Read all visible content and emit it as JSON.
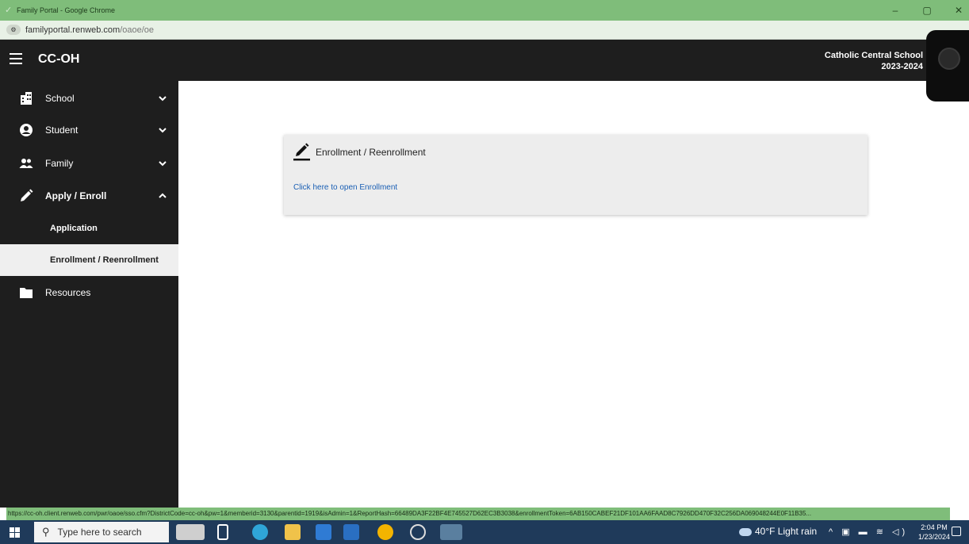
{
  "browser": {
    "window_title": "Family Portal - Google Chrome",
    "url_host": "familyportal.renweb.com",
    "url_path": "/oaoe/oe",
    "controls": {
      "minimize": "–",
      "restore": "▢",
      "close": "✕"
    }
  },
  "header": {
    "app_name": "CC-OH",
    "school_name": "Catholic Central School",
    "school_year": "2023-2024"
  },
  "sidebar": {
    "items": [
      {
        "label": "School",
        "icon": "building-icon"
      },
      {
        "label": "Student",
        "icon": "user-circle-icon"
      },
      {
        "label": "Family",
        "icon": "people-icon"
      },
      {
        "label": "Apply / Enroll",
        "icon": "pencil-icon",
        "expanded": true
      },
      {
        "label": "Resources",
        "icon": "folder-icon"
      }
    ],
    "subitems": [
      {
        "label": "Application"
      },
      {
        "label": "Enrollment / Reenrollment",
        "active": true
      }
    ]
  },
  "card": {
    "title": "Enrollment / Reenrollment",
    "link": "Click here to open Enrollment"
  },
  "status_url": "https://cc-oh.client.renweb.com/pwr/oaoe/sso.cfm?DistrictCode=cc-oh&pw=1&memberid=3130&parentid=1919&isAdmin=1&ReportHash=66489DA3F22BF4E745527D62EC3B3038&enrollmentToken=6AB150CABEF21DF101AA6FAAD8C7926DD470F32C256DA069048244E0F11B35...",
  "taskbar": {
    "search_placeholder": "Type here to search",
    "weather": "40°F  Light rain",
    "time": "2:04 PM",
    "date": "1/23/2024"
  },
  "colors": {
    "chrome_green": "#7fbd7a",
    "app_dark": "#1e1e1e",
    "link_blue": "#1a5fb4",
    "taskbar": "#1f3a5a"
  }
}
